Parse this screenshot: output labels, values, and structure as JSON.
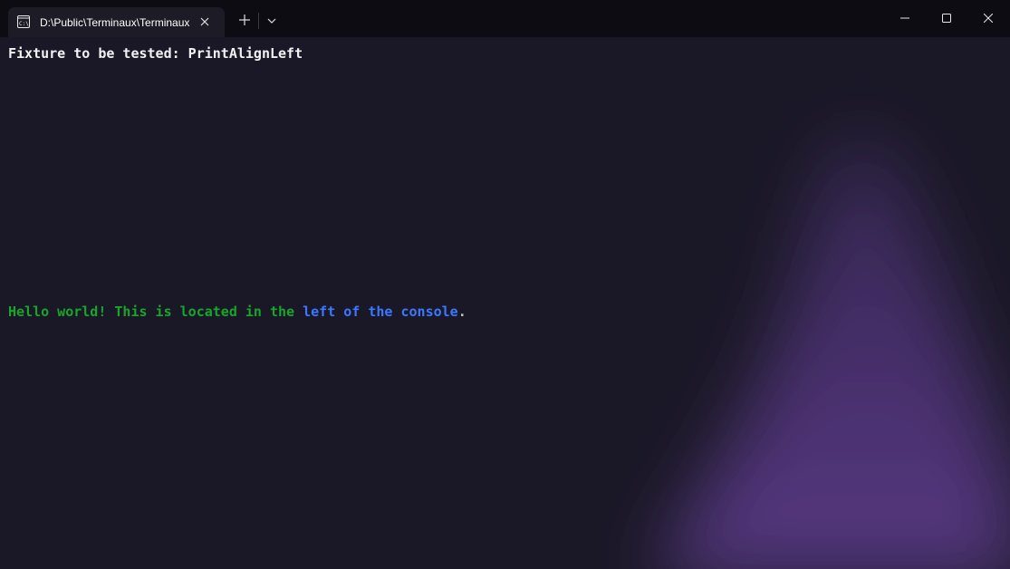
{
  "window": {
    "tab_title": "D:\\Public\\Terminaux\\Terminaux",
    "icons": {
      "tab": "console-icon",
      "close_tab": "close-icon",
      "new_tab": "plus-icon",
      "dropdown": "chevron-down-icon",
      "minimize": "minimize-icon",
      "maximize": "maximize-icon",
      "close": "close-icon"
    }
  },
  "terminal": {
    "line1": "Fixture to be tested: PrintAlignLeft",
    "line2": {
      "part1": "Hello world! This is located in the ",
      "part2": "left of the console",
      "part3": "."
    }
  },
  "colors": {
    "background": "#1a1826",
    "titlebar": "#0d0c13",
    "text_white": "#f2f2f2",
    "text_green": "#16a62a",
    "text_blue": "#3b78ff",
    "glow": "#5a3a86"
  }
}
